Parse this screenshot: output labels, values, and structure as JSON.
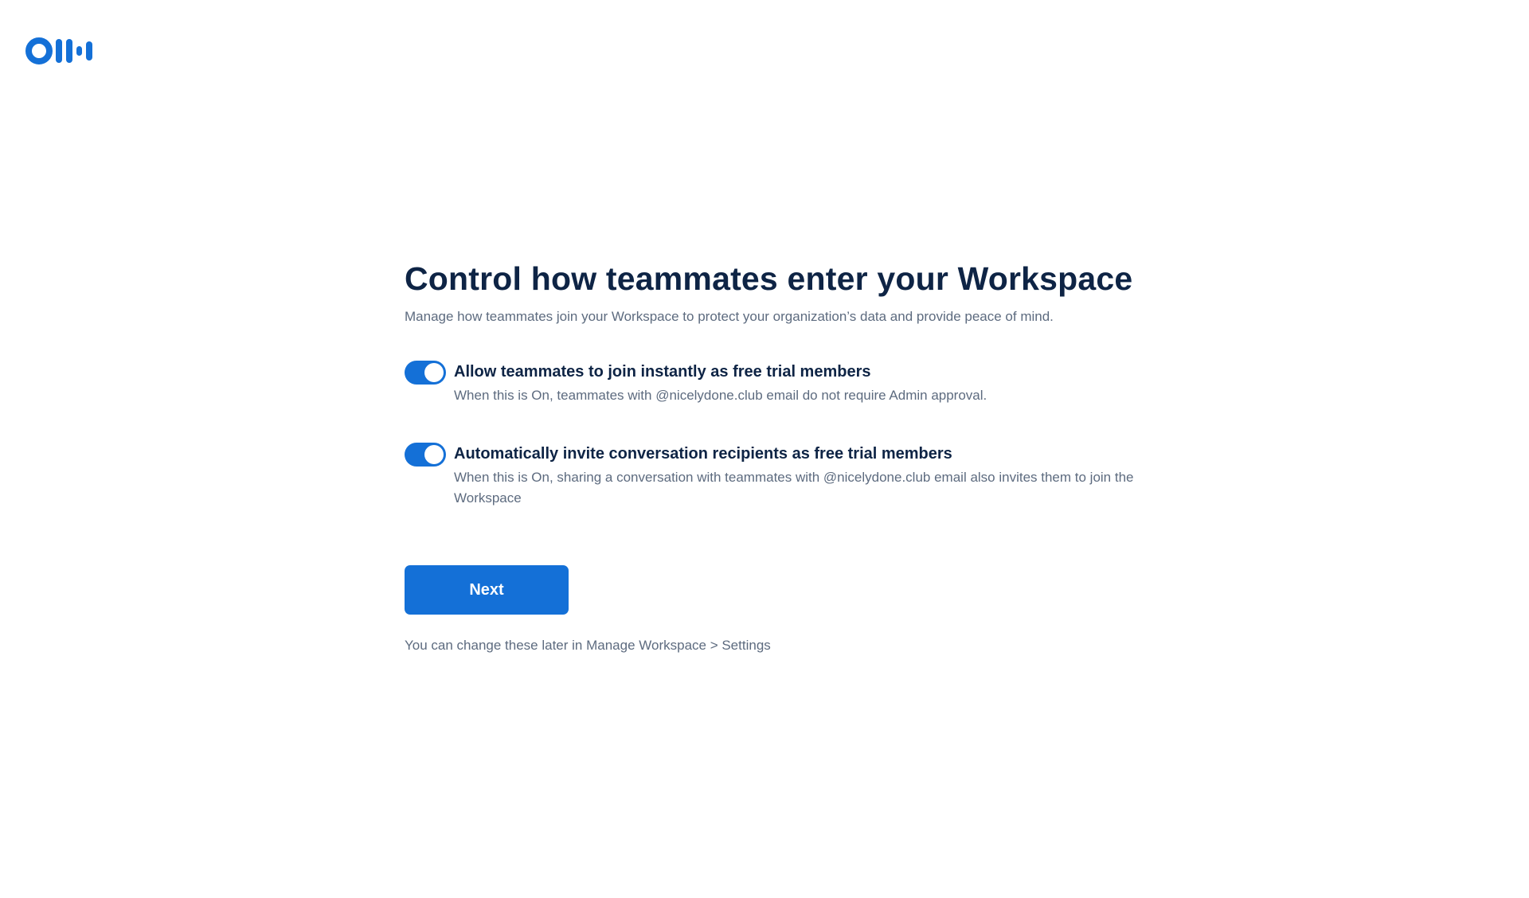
{
  "app": {
    "logo_icon": "otter-logo-icon",
    "accent_color": "#1470d7"
  },
  "main": {
    "title": "Control how teammates enter your Workspace",
    "subtitle": "Manage how teammates join your Workspace to protect your organization’s data and provide peace of mind.",
    "settings": [
      {
        "title": "Allow teammates to join instantly as free trial members",
        "description": "When this is On, teammates with @nicelydone.club email do not require Admin approval.",
        "enabled": true
      },
      {
        "title": "Automatically invite conversation recipients as free trial members",
        "description": "When this is On, sharing a conversation with teammates with @nicelydone.club email also invites them to join the Workspace",
        "enabled": true
      }
    ],
    "next_label": "Next",
    "footer_note": "You can change these later in Manage Workspace > Settings"
  }
}
